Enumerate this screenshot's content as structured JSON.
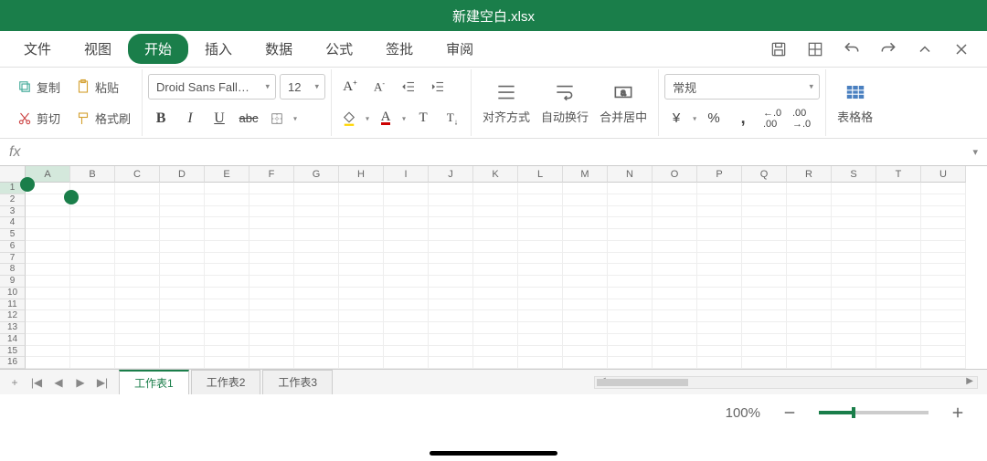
{
  "title": "新建空白.xlsx",
  "menu": {
    "items": [
      "文件",
      "视图",
      "开始",
      "插入",
      "数据",
      "公式",
      "签批",
      "审阅"
    ],
    "active_index": 2
  },
  "toolbar": {
    "copy": "复制",
    "paste": "粘贴",
    "cut": "剪切",
    "format_painter": "格式刷",
    "font_name": "Droid Sans Fall…",
    "font_size": "12",
    "align": "对齐方式",
    "wrap": "自动换行",
    "merge": "合并居中",
    "number_format": "常规",
    "table_format": "表格格"
  },
  "formula_bar": {
    "fx": "fx",
    "value": ""
  },
  "columns": [
    "A",
    "B",
    "C",
    "D",
    "E",
    "F",
    "G",
    "H",
    "I",
    "J",
    "K",
    "L",
    "M",
    "N",
    "O",
    "P",
    "Q",
    "R",
    "S",
    "T",
    "U"
  ],
  "rows": [
    1,
    2,
    3,
    4,
    5,
    6,
    7,
    8,
    9,
    10,
    11,
    12,
    13,
    14,
    15,
    16
  ],
  "sheets": {
    "tabs": [
      "工作表1",
      "工作表2",
      "工作表3"
    ],
    "active_index": 0
  },
  "status": {
    "zoom": "100%"
  }
}
